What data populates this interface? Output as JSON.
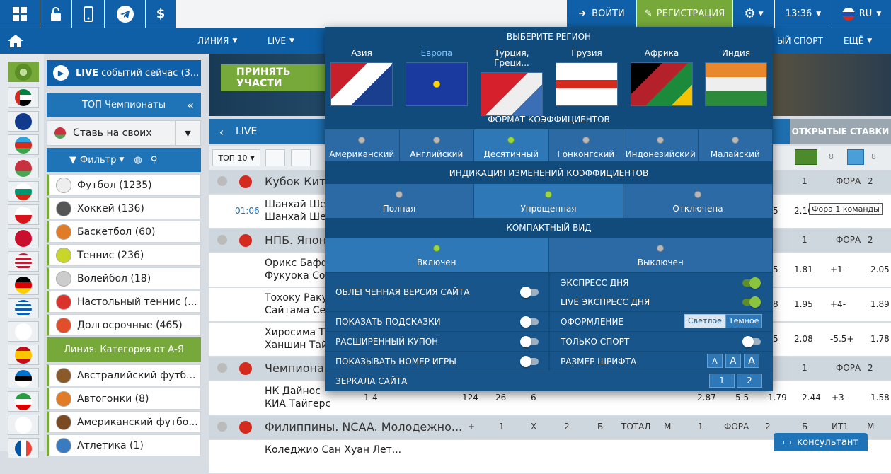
{
  "topbar": {
    "login": "ВОЙТИ",
    "register": "РЕГИСТРАЦИЯ",
    "time": "13:36",
    "lang": "RU",
    "currency": "$"
  },
  "nav": {
    "line": "ЛИНИЯ",
    "live": "LIVE",
    "virtual": "ЫЙ СПОРТ",
    "more": "ЕЩЁ"
  },
  "banner": {
    "accept": "ПРИНЯТЬ УЧАСТИ"
  },
  "sidebar": {
    "live": "LIVE",
    "live_rest": "событий сейчас (3...",
    "top": "ТОП Чемпионаты",
    "fav": "Ставь на своих",
    "filter": "Фильтр",
    "sports": [
      {
        "label": "Футбол (1235)",
        "color": "#eeeeee"
      },
      {
        "label": "Хоккей (136)",
        "color": "#555555"
      },
      {
        "label": "Баскетбол (60)",
        "color": "#e07b27"
      },
      {
        "label": "Теннис (236)",
        "color": "#c8d62a"
      },
      {
        "label": "Волейбол (18)",
        "color": "#cccccc"
      },
      {
        "label": "Настольный теннис (...",
        "color": "#d9332b"
      },
      {
        "label": "Долгосрочные (465)",
        "color": "#e04f2a"
      }
    ],
    "category": "Линия. Категория от А-Я",
    "sports2": [
      {
        "label": "Австралийский футб...",
        "color": "#8b5a2b"
      },
      {
        "label": "Автогонки (8)",
        "color": "#e07b27"
      },
      {
        "label": "Американский футбо...",
        "color": "#7a4a22"
      },
      {
        "label": "Атлетика (1)",
        "color": "#3a7abf"
      }
    ]
  },
  "main": {
    "live_title": "LIVE",
    "open_bets": "ОТКРЫТЫЕ СТАВКИ",
    "top10": "ТОП 10",
    "filter_counts": [
      "8",
      "8"
    ],
    "tooltip": "Фора 1 команды",
    "consult": "консультант",
    "rows": [
      {
        "type": "head",
        "name": "Кубок Кита",
        "cols": [
          "1",
          "ФОРА",
          "2"
        ]
      },
      {
        "type": "event",
        "time": "01:06",
        "t1": "Шанхай Ше",
        "t2": "Шанхай Ше",
        "odds": [
          "5",
          "2.16",
          "",
          ""
        ]
      },
      {
        "type": "head",
        "name": "НПБ. Япон",
        "cols": [
          "1",
          "ФОРА",
          "2"
        ]
      },
      {
        "type": "event",
        "time": "",
        "t1": "Орикс Бафф",
        "t2": "Фукуока Со",
        "odds": [
          "5",
          "1.81",
          "+1-",
          "2.05"
        ]
      },
      {
        "type": "event",
        "time": "",
        "t1": "Тохоку Раку",
        "t2": "Сайтама Се",
        "odds": [
          "8",
          "1.95",
          "+4-",
          "1.89"
        ]
      },
      {
        "type": "event",
        "time": "",
        "t1": "Хиросима Т",
        "t2": "Ханшин Тай",
        "odds": [
          "5",
          "2.08",
          "-5.5+",
          "1.78"
        ]
      },
      {
        "type": "head",
        "name": "Чемпиона",
        "cols": [
          "1",
          "ФОРА",
          "2"
        ]
      },
      {
        "type": "event2",
        "time": "",
        "t1": "НК Дайнос",
        "t2": "КИА Тайгерс",
        "odds": [
          "1-4",
          "124",
          "26",
          "6",
          "2.87",
          "5.5",
          "1.79",
          "2.44",
          "+3-",
          "1.58"
        ]
      },
      {
        "type": "head2",
        "name": "Филиппины. NCAA. Молодежно...",
        "cols": [
          "+",
          "1",
          "X",
          "2",
          "Б",
          "ТОТАЛ",
          "М",
          "1",
          "ФОРА",
          "2",
          "Б",
          "ИТ1",
          "М"
        ]
      },
      {
        "type": "event",
        "time": "",
        "t1": "Коледжио Сан Хуан Лет...",
        "t2": "",
        "odds": []
      }
    ]
  },
  "overlay": {
    "region_title": "ВЫБЕРИТЕ РЕГИОН",
    "regions": [
      "Азия",
      "Европа",
      "Турция, Греци...",
      "Грузия",
      "Африка",
      "Индия"
    ],
    "odds_title": "ФОРМАТ КОЭФФИЦИЕНТОВ",
    "odds_formats": [
      "Американский",
      "Английский",
      "Десятичный",
      "Гонконгский",
      "Индонезийский",
      "Малайский"
    ],
    "change_title": "ИНДИКАЦИЯ ИЗМЕНЕНИЙ КОЭФФИЦИЕНТОВ",
    "change_opts": [
      "Полная",
      "Упрощенная",
      "Отключена"
    ],
    "compact_title": "КОМПАКТНЫЙ ВИД",
    "compact_opts": [
      "Включен",
      "Выключен"
    ],
    "settings": {
      "light": "ОБЛЕГЧЕННАЯ ВЕРСИЯ САЙТА",
      "express": "ЭКСПРЕСС ДНЯ",
      "live_express": "LIVE ЭКСПРЕСС ДНЯ",
      "hints": "ПОКАЗАТЬ ПОДСКАЗКИ",
      "theme": "ОФОРМЛЕНИЕ",
      "theme_light": "Светлое",
      "theme_dark": "Темное",
      "coupon": "РАСШИРЕННЫЙ КУПОН",
      "only_sport": "ТОЛЬКО СПОРТ",
      "game_num": "ПОКАЗЫВАТЬ НОМЕР ИГРЫ",
      "font_size": "РАЗМЕР ШРИФТА",
      "font_a": "A",
      "mirrors": "ЗЕРКАЛА САЙТА",
      "mirror1": "1",
      "mirror2": "2"
    }
  }
}
